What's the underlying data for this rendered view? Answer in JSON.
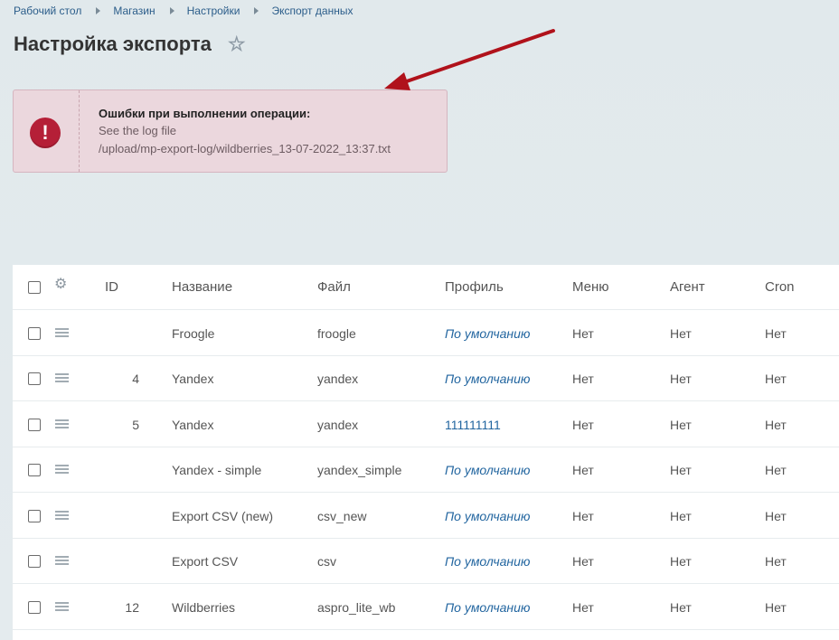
{
  "breadcrumb": [
    "Рабочий стол",
    "Магазин",
    "Настройки",
    "Экспорт данных"
  ],
  "page": {
    "title": "Настройка экспорта"
  },
  "alert": {
    "icon": "exclamation-icon",
    "title": "Ошибки при выполнении операции:",
    "line1": "See the log file",
    "line2": "/upload/mp-export-log/wildberries_13-07-2022_13:37.txt"
  },
  "colors": {
    "alert_bg": "#ebd7dd",
    "alert_icon": "#b51f37",
    "link": "#2366a0",
    "arrow": "#b0121b"
  },
  "table": {
    "headers": {
      "id": "ID",
      "name": "Название",
      "file": "Файл",
      "profile": "Профиль",
      "menu": "Меню",
      "agent": "Агент",
      "cron": "Cron"
    },
    "rows": [
      {
        "id": "",
        "name": "Froogle",
        "file": "froogle",
        "profile": "По умолчанию",
        "profile_style": "italic",
        "menu": "Нет",
        "agent": "Нет",
        "cron": "Нет"
      },
      {
        "id": "4",
        "name": "Yandex",
        "file": "yandex",
        "profile": "По умолчанию",
        "profile_style": "italic",
        "menu": "Нет",
        "agent": "Нет",
        "cron": "Нет"
      },
      {
        "id": "5",
        "name": "Yandex",
        "file": "yandex",
        "profile": "111111111",
        "profile_style": "plain",
        "menu": "Нет",
        "agent": "Нет",
        "cron": "Нет"
      },
      {
        "id": "",
        "name": "Yandex - simple",
        "file": "yandex_simple",
        "profile": "По умолчанию",
        "profile_style": "italic",
        "menu": "Нет",
        "agent": "Нет",
        "cron": "Нет"
      },
      {
        "id": "",
        "name": "Export CSV (new)",
        "file": "csv_new",
        "profile": "По умолчанию",
        "profile_style": "italic",
        "menu": "Нет",
        "agent": "Нет",
        "cron": "Нет"
      },
      {
        "id": "",
        "name": "Export CSV",
        "file": "csv",
        "profile": "По умолчанию",
        "profile_style": "italic",
        "menu": "Нет",
        "agent": "Нет",
        "cron": "Нет"
      },
      {
        "id": "12",
        "name": "Wildberries",
        "file": "aspro_lite_wb",
        "profile": "По умолчанию",
        "profile_style": "italic",
        "menu": "Нет",
        "agent": "Нет",
        "cron": "Нет"
      }
    ]
  }
}
